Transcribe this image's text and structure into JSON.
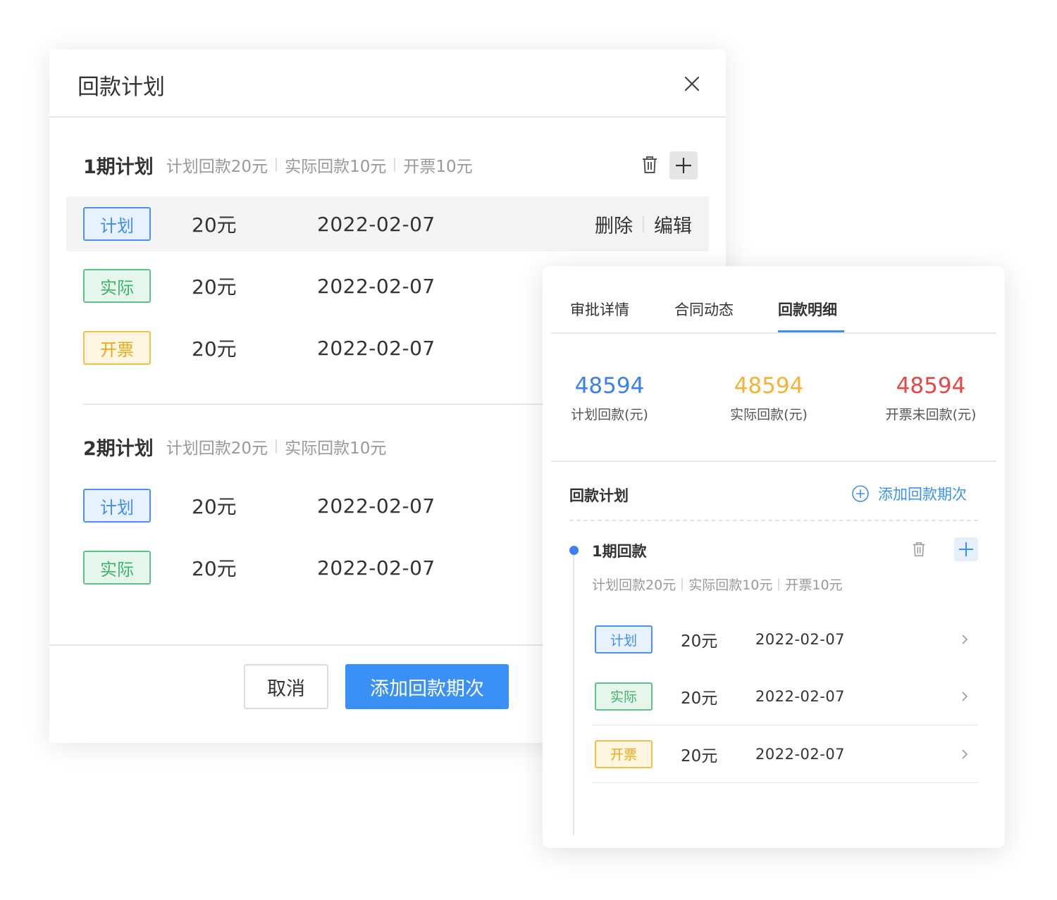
{
  "dialog": {
    "title": "回款计划",
    "plans": [
      {
        "name": "1期计划",
        "summary": [
          "计划回款20元",
          "实际回款10元",
          "开票10元"
        ],
        "rows": [
          {
            "tag": "计划",
            "amount": "20元",
            "date": "2022-02-07",
            "delete": "删除",
            "edit": "编辑"
          },
          {
            "tag": "实际",
            "amount": "20元",
            "date": "2022-02-07"
          },
          {
            "tag": "开票",
            "amount": "20元",
            "date": "2022-02-07"
          }
        ]
      },
      {
        "name": "2期计划",
        "summary": [
          "计划回款20元",
          "实际回款10元"
        ],
        "rows": [
          {
            "tag": "计划",
            "amount": "20元",
            "date": "2022-02-07"
          },
          {
            "tag": "实际",
            "amount": "20元",
            "date": "2022-02-07"
          }
        ]
      }
    ],
    "cancel_label": "取消",
    "confirm_label": "添加回款期次"
  },
  "panel": {
    "tabs": [
      "审批详情",
      "合同动态",
      "回款明细"
    ],
    "active_tab": "回款明细",
    "stats": [
      {
        "value": "48594",
        "label": "计划回款(元)",
        "color": "#3a7ff3"
      },
      {
        "value": "48594",
        "label": "实际回款(元)",
        "color": "#f4b334"
      },
      {
        "value": "48594",
        "label": "开票未回款(元)",
        "color": "#e64646"
      }
    ],
    "section_title": "回款计划",
    "add_link": "添加回款期次",
    "period": {
      "name": "1期回款",
      "summary": [
        "计划回款20元",
        "实际回款10元",
        "开票10元"
      ],
      "rows": [
        {
          "tag": "计划",
          "amount": "20元",
          "date": "2022-02-07"
        },
        {
          "tag": "实际",
          "amount": "20元",
          "date": "2022-02-07"
        },
        {
          "tag": "开票",
          "amount": "20元",
          "date": "2022-02-07"
        }
      ]
    }
  },
  "colors": {
    "primary": "#3a90f5",
    "plan_tag": "#3f8ef7",
    "actual_tag": "#3fb56c",
    "invoice_tag": "#f2a716"
  }
}
